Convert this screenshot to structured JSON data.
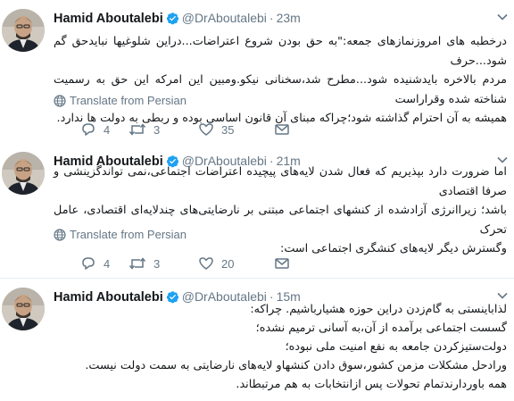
{
  "tweets": [
    {
      "name": "Hamid Aboutalebi",
      "handle": "@DrAboutalebi",
      "separator": "·",
      "time": "23m",
      "text_lines": [
        "درخطبه های امروزنمازهای جمعه:\"به حق بودن شروع اعتراضات...دراین شلوغیها نبایدحق گم شود...حرف",
        "مردم بالاخره بایدشنیده شود...مطرح شد،سخنانی نیکو.ومبین این امرکه این حق به رسمیت شناخته شده وقراراست",
        "همیشه به آن احترام گذاشته شود؛چراکه مبنای آن قانون اساسی بوده و ربطی به دولت ها ندارد."
      ],
      "translate": "Translate from Persian",
      "replies": "4",
      "retweets": "3",
      "likes": "35"
    },
    {
      "name": "Hamid Aboutalebi",
      "handle": "@DrAboutalebi",
      "separator": "·",
      "time": "21m",
      "text_lines": [
        "اما ضرورت دارد بپذیریم که فعال شدن لایه‌های پیچیده اعتراضات اجتماعی،نمی تواندگزینشی و صرفا اقتصادی",
        "باشد؛ زیراانرژی آزادشده از کنشهای اجتماعی مبتنی بر نارضایتی‌های چندلایه‌ای اقتصادی، عامل تحرک",
        "وگسترش دیگر لایه‌های کنشگری اجتماعی است:"
      ],
      "translate": "Translate from Persian",
      "replies": "4",
      "retweets": "3",
      "likes": "20"
    },
    {
      "name": "Hamid Aboutalebi",
      "handle": "@DrAboutalebi",
      "separator": "·",
      "time": "15m",
      "text_lines": [
        "لذاباینستی به گام‌زدن دراین حوزه هشیارباشیم. چراکه:",
        "گسست اجتماعی برآمده از آن،به آسانی ترمیم نشده؛",
        "دولت‌ستیزکردن جامعه به نفع امنیت ملی نبوده؛",
        "ورادحل مشکلات مزمن کشور،سوق دادن کنشهاو لایه‌های نارضایتی به سمت دولت نیست.",
        "همه باوردارندتمام تحولات پس ازانتخابات به هم مرتبطاند."
      ]
    }
  ],
  "colors": {
    "verified": "#1da1f2",
    "muted": "#657786",
    "divider": "#e6ecf0"
  },
  "icons": [
    "verified-badge-icon",
    "chevron-down-icon",
    "globe-icon",
    "reply-icon",
    "retweet-icon",
    "like-icon",
    "direct-message-icon"
  ]
}
